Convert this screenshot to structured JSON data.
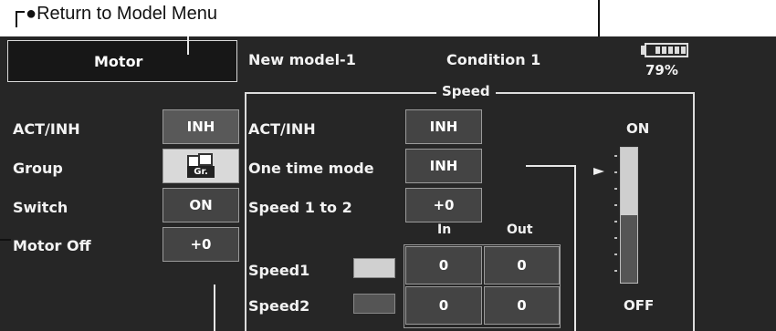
{
  "caption": {
    "return_menu": "●Return to Model Menu"
  },
  "header": {
    "screen_title": "Motor",
    "model_name": "New model-1",
    "condition": "Condition 1",
    "battery_percent": "79%"
  },
  "left_panel": {
    "rows": [
      {
        "label": "ACT/INH",
        "value": "INH"
      },
      {
        "label": "Group",
        "value": "Gr."
      },
      {
        "label": "Switch",
        "value": "ON"
      },
      {
        "label": "Motor Off",
        "value": "+0"
      }
    ]
  },
  "speed_panel": {
    "title": "Speed",
    "rows": [
      {
        "label": "ACT/INH",
        "value": "INH"
      },
      {
        "label": "One time mode",
        "value": "INH"
      },
      {
        "label": "Speed 1 to 2",
        "value": "+0"
      }
    ],
    "col_in": "In",
    "col_out": "Out",
    "speeds": [
      {
        "label": "Speed1",
        "in": "0",
        "out": "0",
        "color": "#d0d0d0"
      },
      {
        "label": "Speed2",
        "in": "0",
        "out": "0",
        "color": "#555555"
      }
    ]
  },
  "indicator": {
    "on_label": "ON",
    "off_label": "OFF",
    "upper_color": "#cfcfcf",
    "lower_color": "#555555"
  }
}
